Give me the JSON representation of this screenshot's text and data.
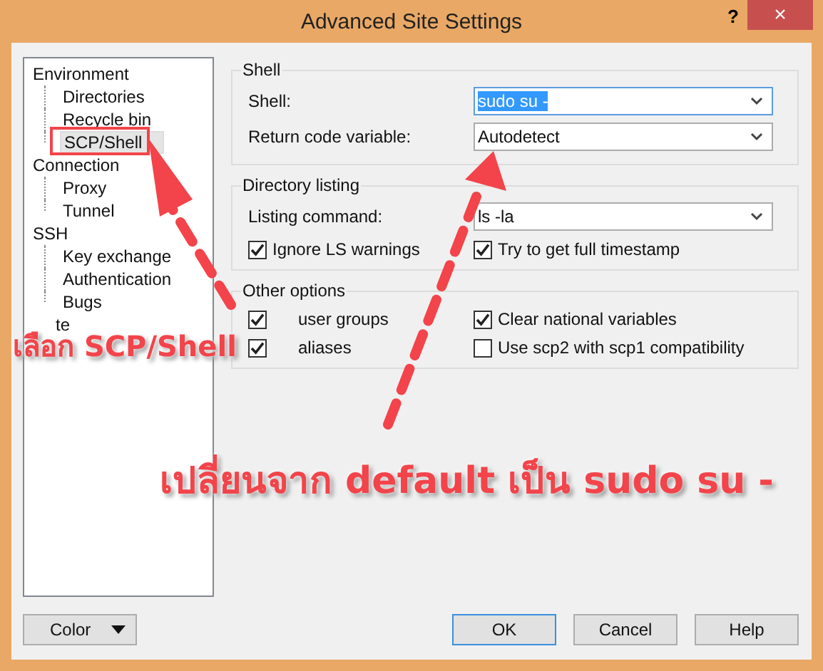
{
  "window": {
    "title": "Advanced Site Settings",
    "help": "?",
    "close": "×"
  },
  "tree": [
    {
      "label": "Environment",
      "selected": false,
      "children": [
        {
          "label": "Directories",
          "selected": false
        },
        {
          "label": "Recycle bin",
          "selected": false
        },
        {
          "label": "SCP/Shell",
          "selected": true
        }
      ]
    },
    {
      "label": "Connection",
      "selected": false,
      "children": [
        {
          "label": "Proxy",
          "selected": false
        },
        {
          "label": "Tunnel",
          "selected": false
        }
      ]
    },
    {
      "label": "SSH",
      "selected": false,
      "children": [
        {
          "label": "Key exchange",
          "selected": false
        },
        {
          "label": "Authentication",
          "selected": false
        },
        {
          "label": "Bugs",
          "selected": false
        }
      ]
    },
    {
      "label": "te",
      "selected": false,
      "kind": "covered"
    }
  ],
  "groups": [
    {
      "title": "Shell",
      "fields": [
        {
          "label": "Shell:",
          "value": "sudo su -",
          "focused": true
        },
        {
          "label": "Return code variable:",
          "value": "Autodetect",
          "focused": false
        }
      ]
    },
    {
      "title": "Directory listing",
      "fields": [
        {
          "label": "Listing command:",
          "value": "ls -la",
          "focused": false
        }
      ],
      "checks": [
        {
          "label": "Ignore LS warnings",
          "checked": true
        },
        {
          "label": "Try to get full timestamp",
          "checked": true
        }
      ]
    },
    {
      "title": "Other options",
      "checks": [
        {
          "label": "user groups",
          "checked": true,
          "kind": "covered"
        },
        {
          "label": "Clear national variables",
          "checked": true
        },
        {
          "label": "aliases",
          "checked": true,
          "kind": "covered"
        },
        {
          "label": "Use scp2 with scp1 compatibility",
          "checked": false
        }
      ]
    }
  ],
  "buttons": [
    {
      "label": "Color",
      "kind": "dropdown"
    },
    {
      "label": "OK",
      "kind": "plain",
      "focused": true
    },
    {
      "label": "Cancel",
      "kind": "plain",
      "focused": false
    },
    {
      "label": "Help",
      "kind": "plain",
      "focused": false
    }
  ],
  "annotations": [
    {
      "text": "เลือก SCP/Shell"
    },
    {
      "text": "เปลี่ยนจาก default เป็น sudo su -"
    }
  ]
}
